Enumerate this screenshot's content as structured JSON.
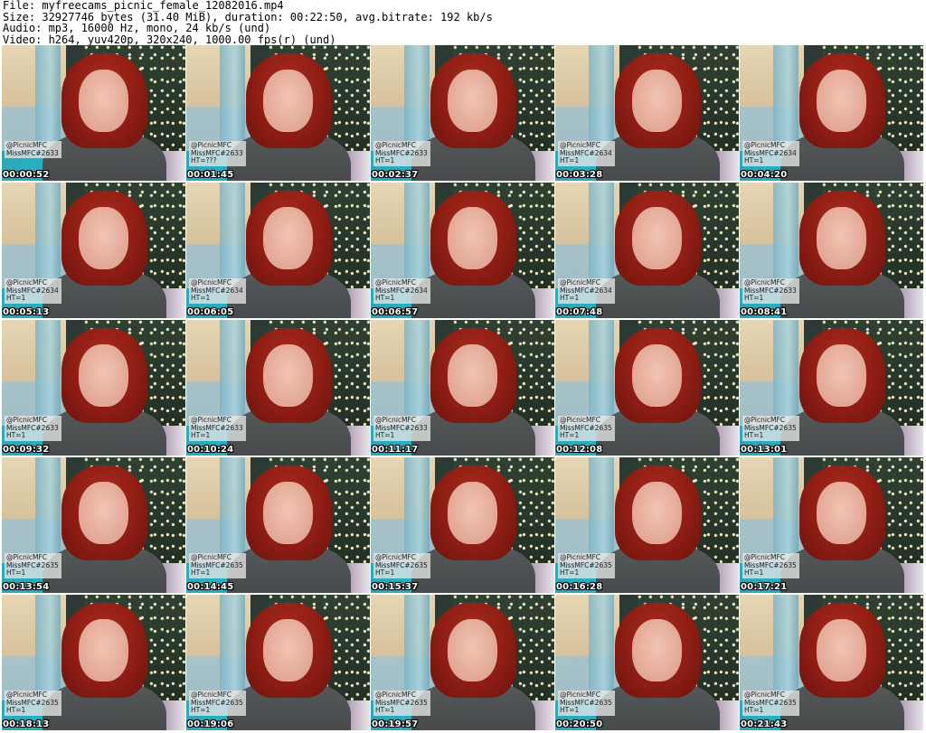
{
  "header": {
    "file": "File: myfreecams_picnic_female_12082016.mp4",
    "size": "Size: 32927746 bytes (31.40 MiB), duration: 00:22:50, avg.bitrate: 192 kb/s",
    "audio": "Audio: mp3, 16000 Hz, mono, 24 kb/s (und)",
    "video": "Video: h264, yuv420p, 320x240, 1000.00 fps(r) (und)"
  },
  "thumbnails": [
    {
      "handle": "@PicnicMFC",
      "mfc": "MissMFC#2633",
      "ht": "",
      "timestamp": "00:00:52"
    },
    {
      "handle": "@PicnicMFC",
      "mfc": "MissMFC#2633",
      "ht": "HT=???",
      "timestamp": "00:01:45"
    },
    {
      "handle": "@PicnicMFC",
      "mfc": "MissMFC#2633",
      "ht": "HT=1",
      "timestamp": "00:02:37"
    },
    {
      "handle": "@PicnicMFC",
      "mfc": "MissMFC#2634",
      "ht": "HT=1",
      "timestamp": "00:03:28"
    },
    {
      "handle": "@PicnicMFC",
      "mfc": "MissMFC#2634",
      "ht": "HT=1",
      "timestamp": "00:04:20"
    },
    {
      "handle": "@PicnicMFC",
      "mfc": "MissMFC#2634",
      "ht": "HT=1",
      "timestamp": "00:05:13"
    },
    {
      "handle": "@PicnicMFC",
      "mfc": "MissMFC#2634",
      "ht": "HT=1",
      "timestamp": "00:06:05"
    },
    {
      "handle": "@PicnicMFC",
      "mfc": "MissMFC#2634",
      "ht": "HT=1",
      "timestamp": "00:06:57"
    },
    {
      "handle": "@PicnicMFC",
      "mfc": "MissMFC#2634",
      "ht": "HT=1",
      "timestamp": "00:07:48"
    },
    {
      "handle": "@PicnicMFC",
      "mfc": "MissMFC#2633",
      "ht": "HT=1",
      "timestamp": "00:08:41"
    },
    {
      "handle": "@PicnicMFC",
      "mfc": "MissMFC#2633",
      "ht": "HT=1",
      "timestamp": "00:09:32"
    },
    {
      "handle": "@PicnicMFC",
      "mfc": "MissMFC#2633",
      "ht": "HT=1",
      "timestamp": "00:10:24"
    },
    {
      "handle": "@PicnicMFC",
      "mfc": "MissMFC#2633",
      "ht": "HT=1",
      "timestamp": "00:11:17"
    },
    {
      "handle": "@PicnicMFC",
      "mfc": "MissMFC#2635",
      "ht": "HT=1",
      "timestamp": "00:12:08"
    },
    {
      "handle": "@PicnicMFC",
      "mfc": "MissMFC#2635",
      "ht": "HT=1",
      "timestamp": "00:13:01"
    },
    {
      "handle": "@PicnicMFC",
      "mfc": "MissMFC#2635",
      "ht": "HT=1",
      "timestamp": "00:13:54"
    },
    {
      "handle": "@PicnicMFC",
      "mfc": "MissMFC#2635",
      "ht": "HT=1",
      "timestamp": "00:14:45"
    },
    {
      "handle": "@PicnicMFC",
      "mfc": "MissMFC#2635",
      "ht": "HT=1",
      "timestamp": "00:15:37"
    },
    {
      "handle": "@PicnicMFC",
      "mfc": "MissMFC#2635",
      "ht": "HT=1",
      "timestamp": "00:16:28"
    },
    {
      "handle": "@PicnicMFC",
      "mfc": "MissMFC#2635",
      "ht": "HT=1",
      "timestamp": "00:17:21"
    },
    {
      "handle": "@PicnicMFC",
      "mfc": "MissMFC#2635",
      "ht": "HT=1",
      "timestamp": "00:18:13"
    },
    {
      "handle": "@PicnicMFC",
      "mfc": "MissMFC#2635",
      "ht": "HT=1",
      "timestamp": "00:19:06"
    },
    {
      "handle": "@PicnicMFC",
      "mfc": "MissMFC#2635",
      "ht": "HT=1",
      "timestamp": "00:19:57"
    },
    {
      "handle": "@PicnicMFC",
      "mfc": "MissMFC#2635",
      "ht": "HT=1",
      "timestamp": "00:20:50"
    },
    {
      "handle": "@PicnicMFC",
      "mfc": "MissMFC#2635",
      "ht": "HT=1",
      "timestamp": "00:21:43"
    }
  ]
}
